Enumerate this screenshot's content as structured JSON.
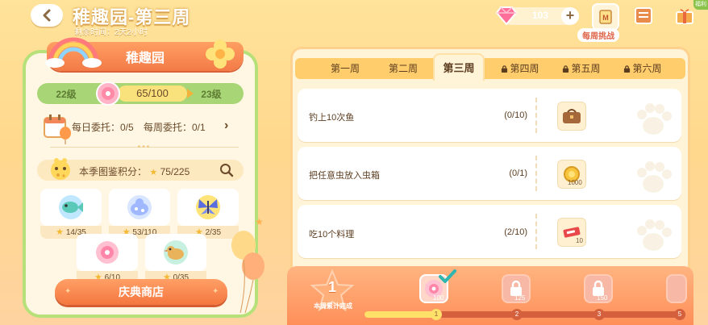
{
  "header": {
    "title": "稚趣园-第三周",
    "countdown": "剩余时间：2天2小时",
    "gem_count": "103",
    "plus_label": "+",
    "weekly_challenge_label": "每周挑战",
    "corner_badge": "福利"
  },
  "left": {
    "banner_title": "稚趣园",
    "level_current": "22级",
    "level_next": "23级",
    "exp_progress": "65/100",
    "daily_label": "每日委托：0/5",
    "weekly_label": "每周委托：0/1",
    "more_arrow": "›",
    "collection_label": "本季图鉴积分：",
    "collection_value": "75/225",
    "slots": [
      {
        "name": "fish",
        "count": "14/35"
      },
      {
        "name": "bug",
        "count": "53/110"
      },
      {
        "name": "butterfly",
        "count": "2/35"
      },
      {
        "name": "pink-coin",
        "count": "6/10"
      },
      {
        "name": "bird",
        "count": "0/35"
      }
    ],
    "shop_button": "庆典商店"
  },
  "tabs": [
    {
      "label": "第一周",
      "locked": false,
      "active": false
    },
    {
      "label": "第二周",
      "locked": false,
      "active": false
    },
    {
      "label": "第三周",
      "locked": false,
      "active": true
    },
    {
      "label": "第四周",
      "locked": true,
      "active": false
    },
    {
      "label": "第五周",
      "locked": true,
      "active": false
    },
    {
      "label": "第六周",
      "locked": true,
      "active": false
    }
  ],
  "tasks": [
    {
      "name": "钓上10次鱼",
      "progress": "(0/10)",
      "reward_icon": "bag-icon",
      "reward_qty": ""
    },
    {
      "name": "把任意虫放入虫箱",
      "progress": "(0/1)",
      "reward_icon": "gold-coin-icon",
      "reward_qty": "1000"
    },
    {
      "name": "吃10个料理",
      "progress": "(2/10)",
      "reward_icon": "ticket-icon",
      "reward_qty": "10"
    }
  ],
  "weekly_progress": {
    "completed": "1",
    "label": "本周累计完成",
    "milestones": [
      {
        "index": "1",
        "qty": "100",
        "claimed": true,
        "locked": false
      },
      {
        "index": "2",
        "qty": "125",
        "claimed": false,
        "locked": true
      },
      {
        "index": "3",
        "qty": "150",
        "claimed": false,
        "locked": true
      },
      {
        "index": "5",
        "qty": "",
        "claimed": false,
        "locked": true
      }
    ]
  },
  "colors": {
    "accent_orange": "#f4773f",
    "level_green": "#a8d676",
    "tab_yellow": "#ffcd6b",
    "track_fill": "#ffe068"
  }
}
